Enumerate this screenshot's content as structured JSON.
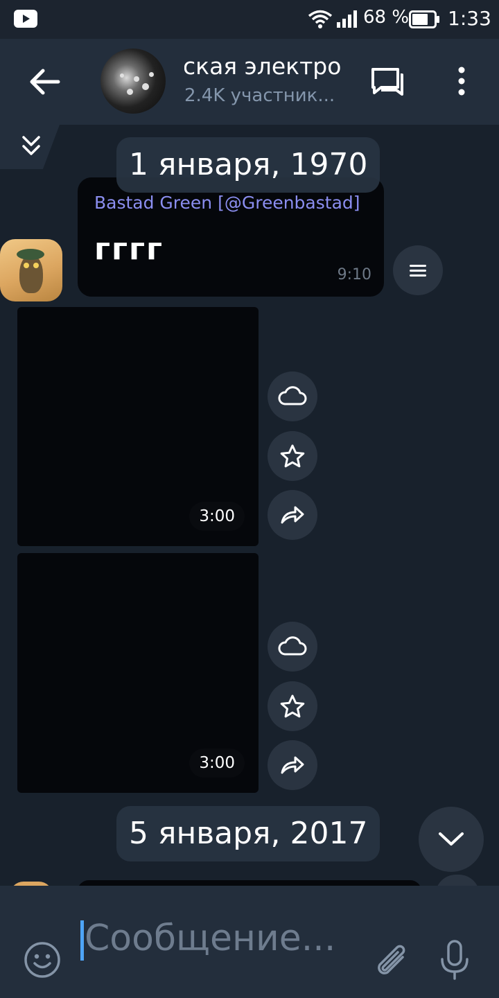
{
  "status_bar": {
    "battery": "68 %",
    "time": "1:33"
  },
  "header": {
    "title": "ская электро",
    "subtitle": "2.4K участник..."
  },
  "dates": {
    "first": "1 января, 1970",
    "second": "5 января, 2017"
  },
  "message": {
    "author": "Bastad Green [@Greenbastad]",
    "text": "гггг",
    "time": "9:10"
  },
  "videos": [
    {
      "duration": "3:00"
    },
    {
      "duration": "3:00"
    }
  ],
  "composer": {
    "placeholder": "Сообщение..."
  },
  "icons": {
    "status": [
      "youtube-icon",
      "wifi-icon",
      "signal-icon",
      "battery-icon"
    ],
    "header": [
      "back-arrow-icon",
      "discussion-icon",
      "more-vert-icon"
    ],
    "actions": [
      "cloud-icon",
      "star-icon",
      "share-icon",
      "menu-icon",
      "chevron-down-icon"
    ],
    "composer": [
      "emoji-icon",
      "attach-icon",
      "mic-icon"
    ]
  }
}
